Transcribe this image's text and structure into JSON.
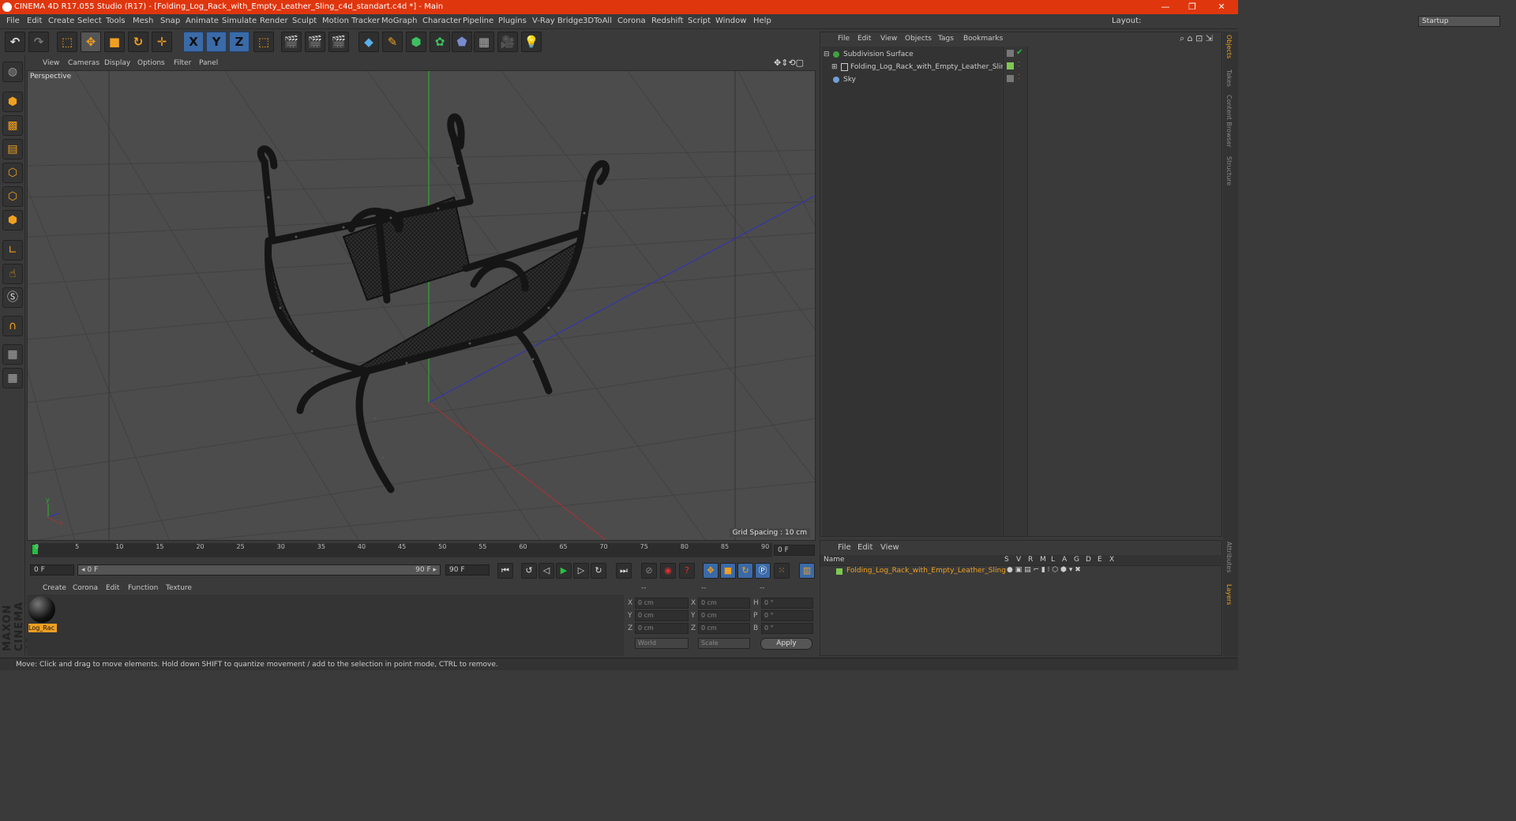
{
  "window": {
    "title": "CINEMA 4D R17.055 Studio (R17) - [Folding_Log_Rack_with_Empty_Leather_Sling_c4d_standart.c4d *] - Main",
    "controls": [
      "—",
      "❐",
      "✕"
    ]
  },
  "menu": [
    "File",
    "Edit",
    "Create",
    "Select",
    "Tools",
    "Mesh",
    "Snap",
    "Animate",
    "Simulate",
    "Render",
    "Sculpt",
    "Motion Tracker",
    "MoGraph",
    "Character",
    "Pipeline",
    "Plugins",
    "V-Ray Bridge",
    "3DToAll",
    "Corona",
    "Redshift",
    "Script",
    "Window",
    "Help"
  ],
  "layout": {
    "label": "Layout:",
    "value": "Startup"
  },
  "toolbar": {
    "axis_x": "X",
    "axis_y": "Y",
    "axis_z": "Z"
  },
  "viewport": {
    "menu": [
      "View",
      "Cameras",
      "Display",
      "Options",
      "Filter",
      "Panel"
    ],
    "label": "Perspective",
    "grid_spacing": "Grid Spacing : 10 cm"
  },
  "timeline": {
    "ticks": [
      "0",
      "5",
      "10",
      "15",
      "20",
      "25",
      "30",
      "35",
      "40",
      "45",
      "50",
      "55",
      "60",
      "65",
      "70",
      "75",
      "80",
      "85",
      "90"
    ],
    "current_frame": "0 F",
    "start_field": "0 F",
    "range_start": "◂ 0 F",
    "range_end": "90 F ▸",
    "end_field": "90 F"
  },
  "materials": {
    "menu": [
      "Create",
      "Corona",
      "Edit",
      "Function",
      "Texture"
    ],
    "items": [
      {
        "name": "Log_Rac"
      }
    ]
  },
  "attributes": {
    "header": [
      "--",
      "--",
      "--"
    ],
    "rows": [
      {
        "l1": "X",
        "v1": "0 cm",
        "l2": "X",
        "v2": "0 cm",
        "l3": "H",
        "v3": "0 °"
      },
      {
        "l1": "Y",
        "v1": "0 cm",
        "l2": "Y",
        "v2": "0 cm",
        "l3": "P",
        "v3": "0 °"
      },
      {
        "l1": "Z",
        "v1": "0 cm",
        "l2": "Z",
        "v2": "0 cm",
        "l3": "B",
        "v3": "0 °"
      }
    ],
    "coord_mode": "World",
    "size_mode": "Scale",
    "apply": "Apply"
  },
  "object_manager": {
    "menu": [
      "File",
      "Edit",
      "View",
      "Objects",
      "Tags",
      "Bookmarks"
    ],
    "objects": [
      {
        "name": "Subdivision Surface",
        "color": "#3fa03f"
      },
      {
        "name": "Folding_Log_Rack_with_Empty_Leather_Sling",
        "color": "#7ec850"
      },
      {
        "name": "Sky",
        "color": "#6fa0d8"
      }
    ]
  },
  "layer_manager": {
    "menu": [
      "File",
      "Edit",
      "View"
    ],
    "columns": [
      "Name",
      "S",
      "V",
      "R",
      "M",
      "L",
      "A",
      "G",
      "D",
      "E",
      "X"
    ],
    "layers": [
      {
        "name": "Folding_Log_Rack_with_Empty_Leather_Sling",
        "color": "#7ec850"
      }
    ]
  },
  "side_tabs": [
    "Objects",
    "Takes",
    "Content Browser",
    "Structure"
  ],
  "side_tabs_bottom": [
    "Attributes",
    "Layers"
  ],
  "status": "Move: Click and drag to move elements. Hold down SHIFT to quantize movement / add to the selection in point mode, CTRL to remove.",
  "brand": "MAXON CINEMA 4D"
}
